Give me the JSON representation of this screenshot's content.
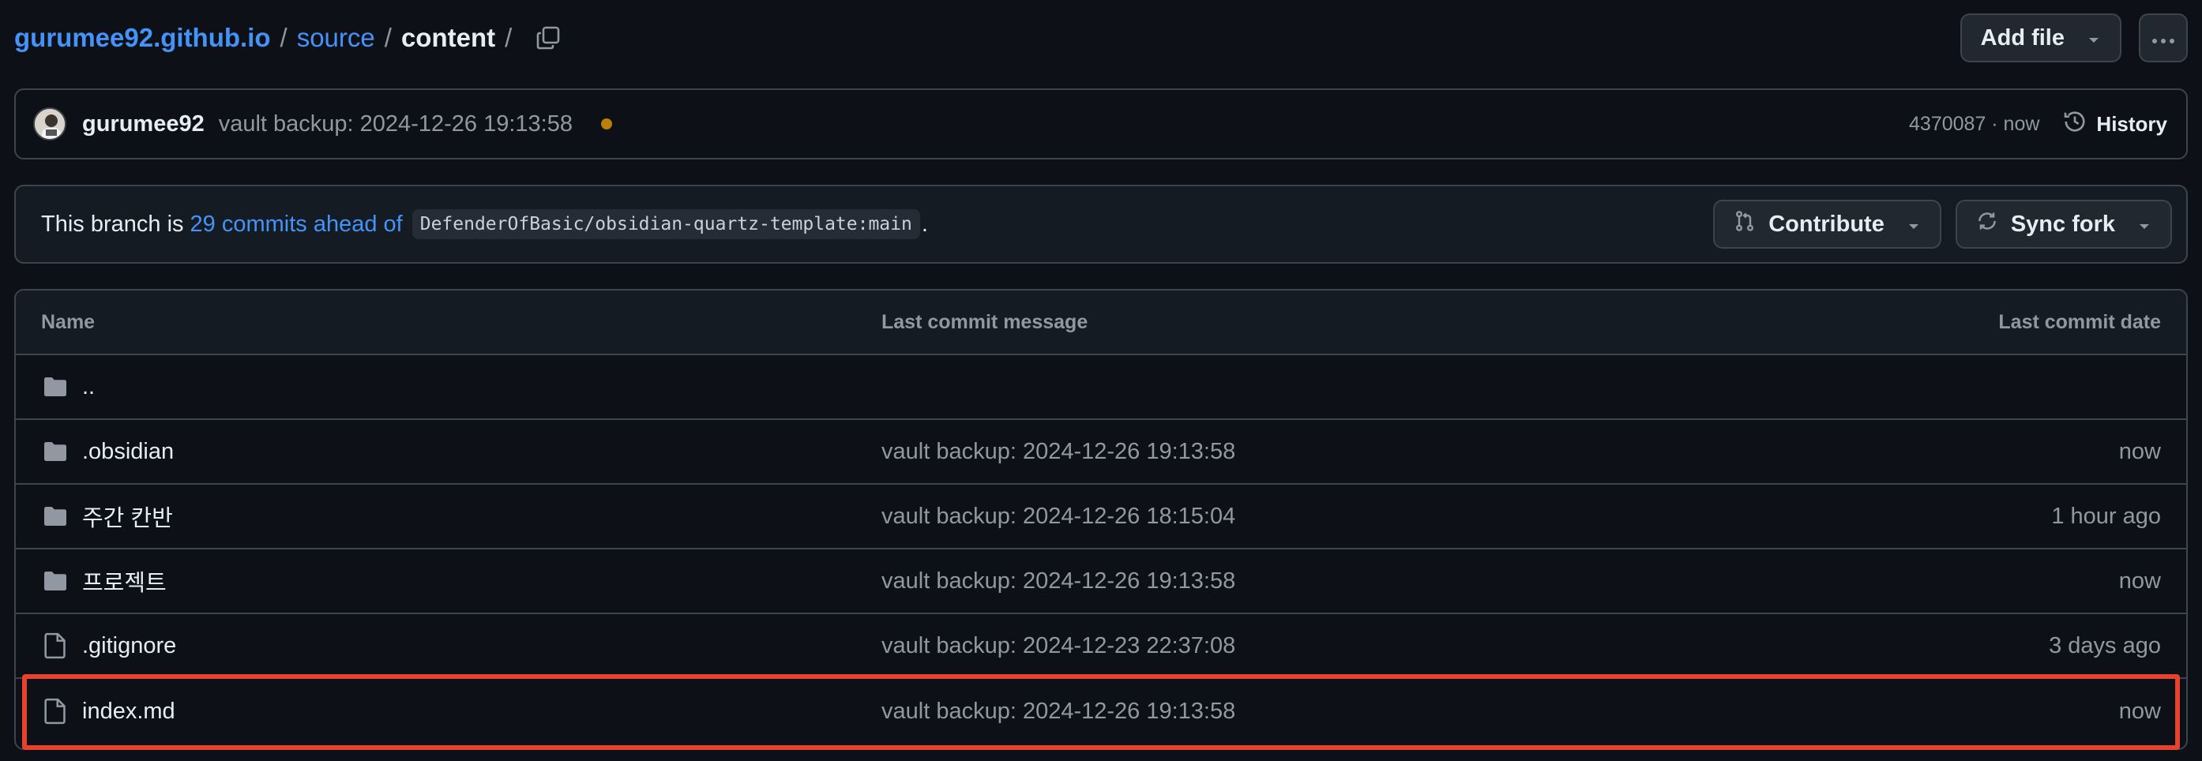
{
  "breadcrumb": {
    "repo": "gurumee92.github.io",
    "sep1": "/",
    "folder": "source",
    "sep2": "/",
    "current": "content",
    "sep3": "/"
  },
  "actions": {
    "add_file": "Add file"
  },
  "commit": {
    "user": "gurumee92",
    "message": "vault backup: 2024-12-26 19:13:58",
    "hash_time": "4370087 · now",
    "history_label": "History",
    "status_color": "#bb8009"
  },
  "branch": {
    "prefix": "This branch is",
    "ahead": "29 commits ahead of",
    "upstream": "DefenderOfBasic/obsidian-quartz-template:main",
    "suffix": ".",
    "contribute": "Contribute",
    "sync_fork": "Sync fork"
  },
  "table": {
    "headers": {
      "name": "Name",
      "message": "Last commit message",
      "date": "Last commit date"
    },
    "rows": [
      {
        "icon": "folder-icon",
        "name": "..",
        "message": "",
        "date": ""
      },
      {
        "icon": "folder-icon",
        "name": ".obsidian",
        "message": "vault backup: 2024-12-26 19:13:58",
        "date": "now"
      },
      {
        "icon": "folder-icon",
        "name": "주간 칸반",
        "message": "vault backup: 2024-12-26 18:15:04",
        "date": "1 hour ago"
      },
      {
        "icon": "folder-icon",
        "name": "프로젝트",
        "message": "vault backup: 2024-12-26 19:13:58",
        "date": "now"
      },
      {
        "icon": "file-icon",
        "name": ".gitignore",
        "message": "vault backup: 2024-12-23 22:37:08",
        "date": "3 days ago"
      },
      {
        "icon": "file-icon",
        "name": "index.md",
        "message": "vault backup: 2024-12-26 19:13:58",
        "date": "now"
      }
    ]
  },
  "colors": {
    "link": "#4493f8",
    "highlight": "#e5432d",
    "background": "#0d1117"
  }
}
